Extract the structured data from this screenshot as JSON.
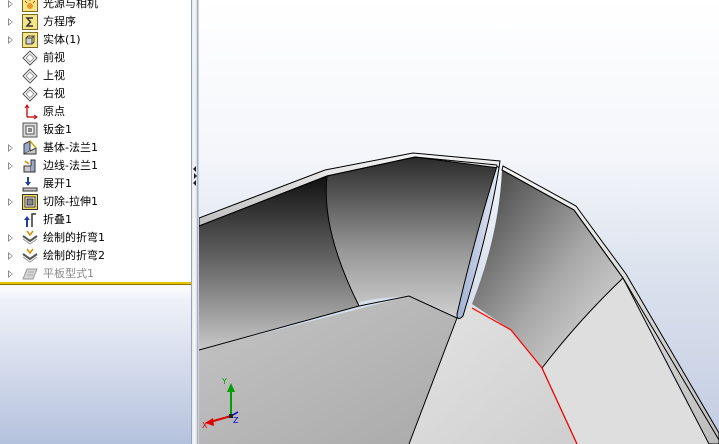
{
  "feature_tree": {
    "items": [
      {
        "label": "光源与相机",
        "icon": "lights-cameras-icon",
        "expandable": true,
        "dimmed": false
      },
      {
        "label": "方程序",
        "icon": "equations-icon",
        "expandable": true,
        "dimmed": false
      },
      {
        "label": "实体(1)",
        "icon": "solid-bodies-icon",
        "expandable": true,
        "dimmed": false
      },
      {
        "label": "前视",
        "icon": "plane-icon",
        "expandable": false,
        "dimmed": false
      },
      {
        "label": "上视",
        "icon": "plane-icon",
        "expandable": false,
        "dimmed": false
      },
      {
        "label": "右视",
        "icon": "plane-icon",
        "expandable": false,
        "dimmed": false
      },
      {
        "label": "原点",
        "icon": "origin-icon",
        "expandable": false,
        "dimmed": false
      },
      {
        "label": "钣金1",
        "icon": "sheet-metal-icon",
        "expandable": false,
        "dimmed": false
      },
      {
        "label": "基体-法兰1",
        "icon": "base-flange-icon",
        "expandable": true,
        "dimmed": false
      },
      {
        "label": "边线-法兰1",
        "icon": "edge-flange-icon",
        "expandable": true,
        "dimmed": false
      },
      {
        "label": "展开1",
        "icon": "unfold-icon",
        "expandable": false,
        "dimmed": false
      },
      {
        "label": "切除-拉伸1",
        "icon": "cut-extrude-icon",
        "expandable": true,
        "dimmed": false
      },
      {
        "label": "折叠1",
        "icon": "fold-icon",
        "expandable": false,
        "dimmed": false
      },
      {
        "label": "绘制的折弯1",
        "icon": "sketched-bend-icon",
        "expandable": true,
        "dimmed": false
      },
      {
        "label": "绘制的折弯2",
        "icon": "sketched-bend-icon",
        "expandable": true,
        "dimmed": false
      },
      {
        "label": "平板型式1",
        "icon": "flat-pattern-icon",
        "expandable": true,
        "dimmed": true
      }
    ],
    "rollback_bar_color": "#e2c400"
  },
  "viewport": {
    "triad": {
      "x_label": "X",
      "y_label": "Y",
      "z_label": "Z"
    },
    "colors": {
      "x_axis": "#e00000",
      "y_axis": "#00a000",
      "z_axis": "#0000d0",
      "sketch_line": "#ff0000",
      "model_edge": "#000000"
    }
  }
}
